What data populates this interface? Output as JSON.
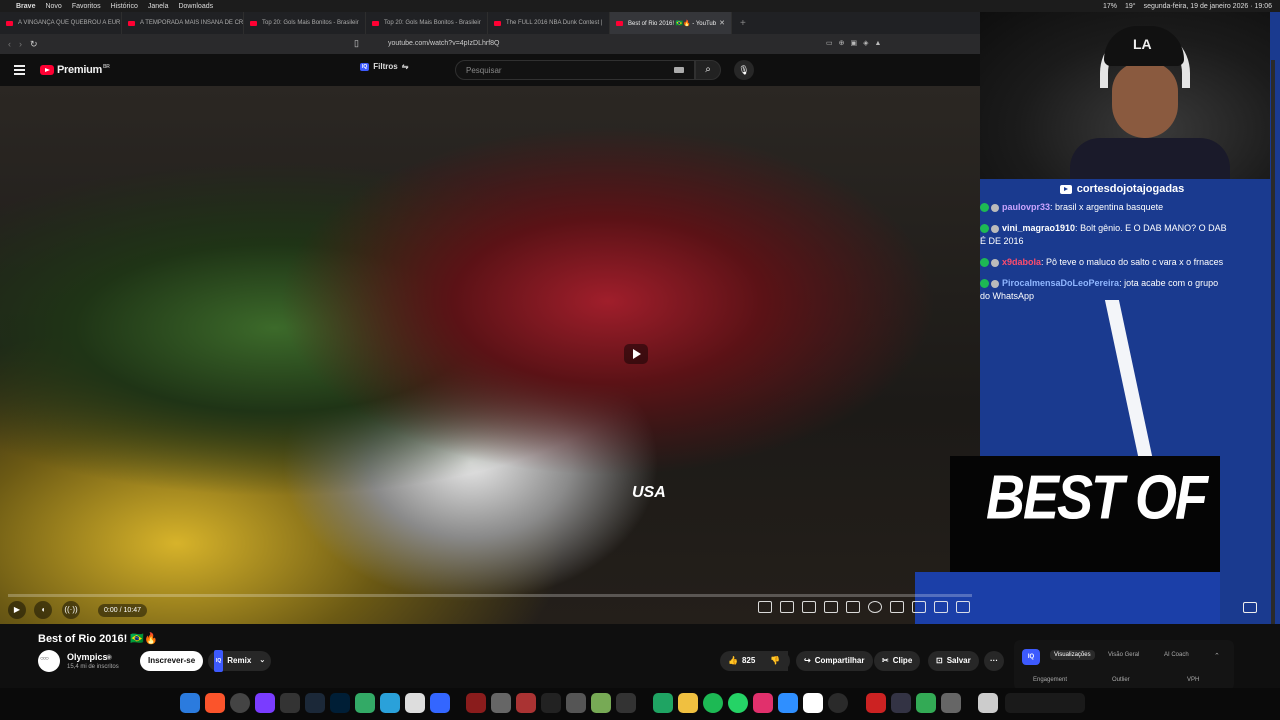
{
  "menubar": {
    "app": "Brave",
    "items": [
      "Novo",
      "Favoritos",
      "Histórico",
      "Janela",
      "Downloads"
    ],
    "battery": "17%",
    "temp": "19°",
    "datetime": "segunda-feira, 19 de janeiro 2026 · 19:06"
  },
  "tabs": [
    {
      "label": "A VINGANÇA QUE QUEBROU A EUR",
      "active": false
    },
    {
      "label": "A TEMPORADA MAIS INSANA DE CR",
      "active": false
    },
    {
      "label": "Top 20: Gols Mais Bonitos - Brasileir",
      "active": false
    },
    {
      "label": "Top 20: Gols Mais Bonitos - Brasileir",
      "active": false
    },
    {
      "label": "The FULL 2016 NBA Dunk Contest |",
      "active": false
    },
    {
      "label": "Best of Rio 2016! 🇧🇷🔥 - YouTub",
      "active": true
    }
  ],
  "address": {
    "url": "youtube.com/watch?v=4pIzDLhrf8Q"
  },
  "yt": {
    "logo": "Premium",
    "logo_region": "BR",
    "filters_label": "Filtros",
    "filters_badge": "IQ",
    "search_placeholder": "Pesquisar"
  },
  "video": {
    "overlay_text_usa": "USA",
    "overlay_text_bestof": "BEST OF",
    "timecode": "0:00 / 10:47"
  },
  "stream": {
    "channel_tag": "cortesdojotajogadas",
    "chat": [
      {
        "user": "paulovpr33",
        "text": "brasil x argentina basquete",
        "user_color": "#c9a4ff"
      },
      {
        "user": "vini_magrao1910",
        "text": "Bolt gênio. E O DAB MANO? O DAB É DE 2016",
        "user_color": "#ffffff"
      },
      {
        "user": "x9dabola",
        "text": "Pô teve o maluco do salto c vara x o frnaces",
        "user_color": "#ff4d6d"
      },
      {
        "user": "PirocaImensaDoLeoPereira",
        "text": "jota acabe com o grupo do WhatsApp",
        "user_color": "#8fb6ff"
      }
    ]
  },
  "meta": {
    "title": "Best of Rio 2016! 🇧🇷🔥",
    "channel": "Olympics",
    "subs": "15,4 mi de inscritos",
    "subscribe": "Inscrever-se",
    "remix": "Remix",
    "remix_badge": "IQ",
    "likes": "825",
    "share": "Compartilhar",
    "clip": "Clipe",
    "save": "Salvar"
  },
  "iq_panel": {
    "badge": "IQ",
    "tabs": [
      "Visualizações",
      "Visão Geral",
      "AI Coach"
    ],
    "subcols": [
      "Engagement",
      "Outlier",
      "VPH"
    ]
  },
  "colors": {
    "yt_red": "#ff0033",
    "accent_blue": "#3d5afe",
    "stream_blue": "#1a3a8f"
  }
}
